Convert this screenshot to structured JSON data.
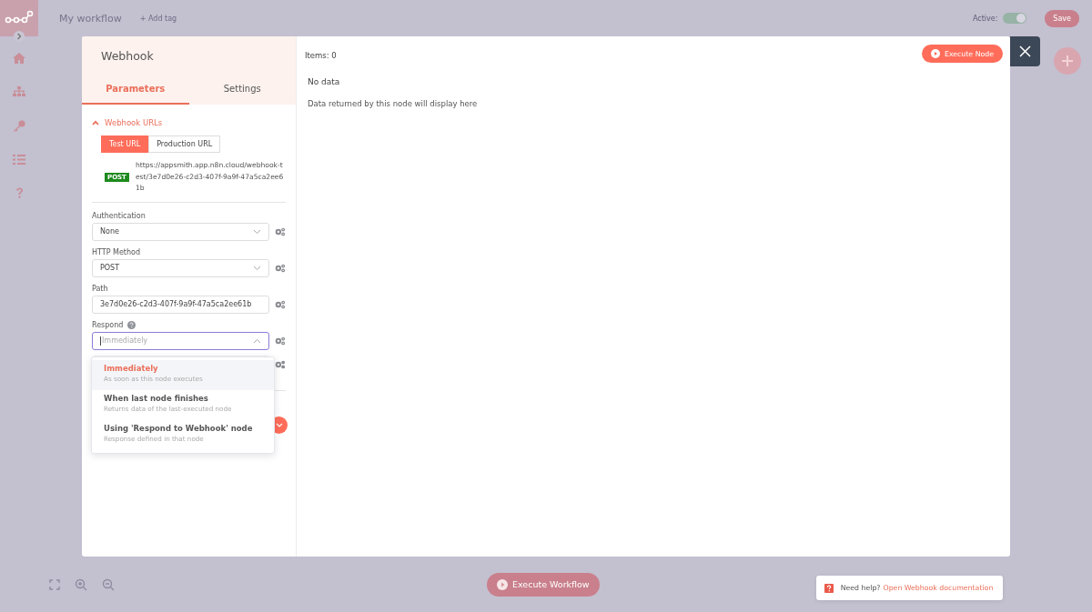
{
  "header": {
    "workflow_name": "My workflow",
    "add_tag": "+ Add tag",
    "active_label": "Active:",
    "active": true,
    "save": "Save"
  },
  "node": {
    "title": "Webhook",
    "tabs": [
      {
        "label": "Parameters",
        "selected": true
      },
      {
        "label": "Settings",
        "selected": false
      }
    ],
    "webhook_urls": {
      "label": "Webhook URLs",
      "expanded": true,
      "url_tabs": [
        {
          "label": "Test URL",
          "selected": true
        },
        {
          "label": "Production URL",
          "selected": false
        }
      ],
      "method": "POST",
      "url": "https://appsmith.app.n8n.cloud/webhook-test/3e7d0e26-c2d3-407f-9a9f-47a5ca2ee61b"
    },
    "fields": [
      {
        "label": "Authentication",
        "kind": "select",
        "value": "None",
        "focused": false,
        "help": false
      },
      {
        "label": "HTTP Method",
        "kind": "select",
        "value": "POST",
        "focused": false,
        "help": false
      },
      {
        "label": "Path",
        "kind": "input",
        "value": "3e7d0e26-c2d3-407f-9a9f-47a5ca2ee61b",
        "focused": false,
        "help": false
      },
      {
        "label": "Respond",
        "kind": "select",
        "placeholder": "Immediately",
        "focused": true,
        "help": true
      }
    ],
    "dropdown": {
      "options": [
        {
          "title": "Immediately",
          "description": "As soon as this node executes",
          "selected": true
        },
        {
          "title": "When last node finishes",
          "description": "Returns data of the last-executed node",
          "selected": false
        },
        {
          "title": "Using 'Respond to Webhook' node",
          "description": "Response defined in that node",
          "selected": false
        }
      ]
    }
  },
  "output": {
    "items": "Items: 0",
    "execute": "Execute Node",
    "empty_title": "No data",
    "empty_text": "Data returned by this node will display here"
  },
  "footer": {
    "execute_workflow": "Execute Workflow",
    "help_prefix": "Need help?",
    "help_link": "Open Webhook documentation"
  }
}
